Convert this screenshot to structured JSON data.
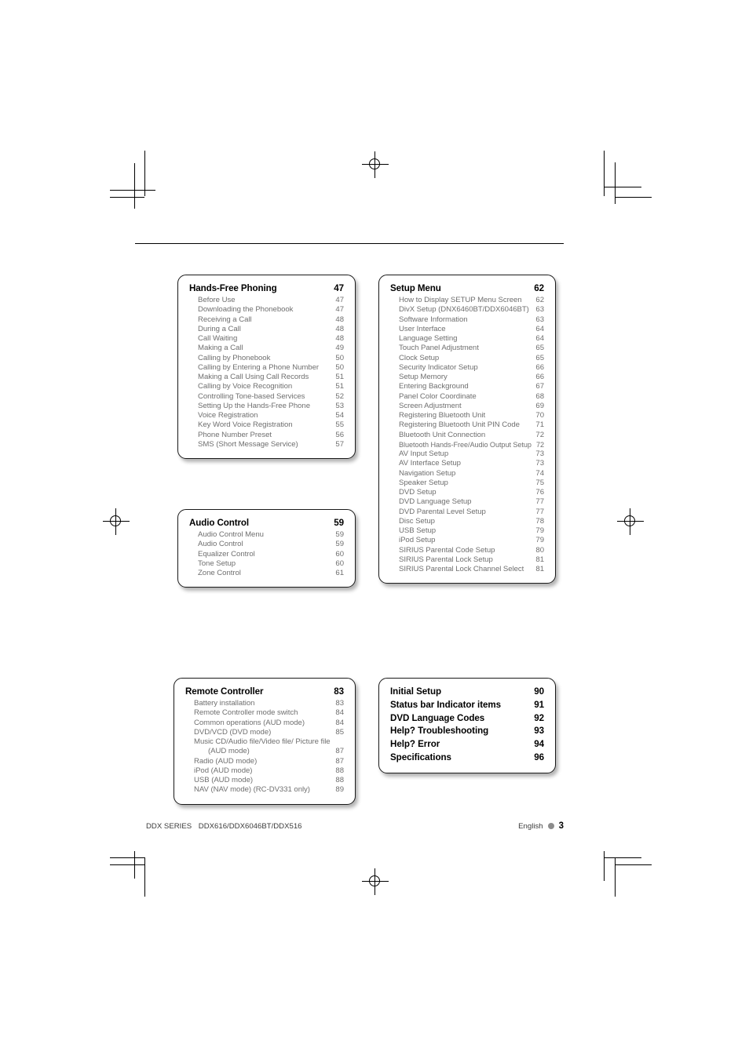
{
  "page": {
    "footer": {
      "series_label": "DDX SERIES",
      "models": "DDX616/DDX6046BT/DDX516",
      "language": "English",
      "page_number": "3"
    }
  },
  "toc_boxes": [
    {
      "id": "hands-free-phoning",
      "title": "Hands-Free Phoning",
      "page": "47",
      "items": [
        {
          "label": "Before Use",
          "page": "47"
        },
        {
          "label": "Downloading the Phonebook",
          "page": "47"
        },
        {
          "label": "Receiving a Call",
          "page": "48"
        },
        {
          "label": "During a Call",
          "page": "48"
        },
        {
          "label": "Call Waiting",
          "page": "48"
        },
        {
          "label": "Making a Call",
          "page": "49"
        },
        {
          "label": "Calling by Phonebook",
          "page": "50"
        },
        {
          "label": "Calling by Entering a Phone Number",
          "page": "50"
        },
        {
          "label": "Making a Call Using Call Records",
          "page": "51"
        },
        {
          "label": "Calling by Voice Recognition",
          "page": "51"
        },
        {
          "label": "Controlling Tone-based Services",
          "page": "52"
        },
        {
          "label": "Setting Up the Hands-Free Phone",
          "page": "53"
        },
        {
          "label": "Voice Registration",
          "page": "54"
        },
        {
          "label": "Key Word Voice Registration",
          "page": "55"
        },
        {
          "label": "Phone Number Preset",
          "page": "56"
        },
        {
          "label": "SMS (Short Message Service)",
          "page": "57"
        }
      ]
    },
    {
      "id": "setup-menu",
      "title": "Setup Menu",
      "page": "62",
      "items": [
        {
          "label": "How to Display SETUP Menu Screen",
          "page": "62"
        },
        {
          "label": "DivX Setup (DNX6460BT/DDX6046BT)",
          "page": "63"
        },
        {
          "label": "Software Information",
          "page": "63"
        },
        {
          "label": "User Interface",
          "page": "64"
        },
        {
          "label": "Language Setting",
          "page": "64"
        },
        {
          "label": "Touch Panel Adjustment",
          "page": "65"
        },
        {
          "label": "Clock Setup",
          "page": "65"
        },
        {
          "label": "Security Indicator Setup",
          "page": "66"
        },
        {
          "label": "Setup Memory",
          "page": "66"
        },
        {
          "label": "Entering Background",
          "page": "67"
        },
        {
          "label": "Panel Color Coordinate",
          "page": "68"
        },
        {
          "label": "Screen Adjustment",
          "page": "69"
        },
        {
          "label": "Registering Bluetooth Unit",
          "page": "70"
        },
        {
          "label": "Registering Bluetooth Unit PIN Code",
          "page": "71"
        },
        {
          "label": "Bluetooth Unit Connection",
          "page": "72"
        },
        {
          "label": "Bluetooth Hands-Free/Audio Output Setup",
          "page": "72"
        },
        {
          "label": "AV Input Setup",
          "page": "73"
        },
        {
          "label": "AV Interface Setup",
          "page": "73"
        },
        {
          "label": "Navigation Setup",
          "page": "74"
        },
        {
          "label": "Speaker Setup",
          "page": "75"
        },
        {
          "label": "DVD Setup",
          "page": "76"
        },
        {
          "label": "DVD Language Setup",
          "page": "77"
        },
        {
          "label": "DVD Parental Level Setup",
          "page": "77"
        },
        {
          "label": "Disc Setup",
          "page": "78"
        },
        {
          "label": "USB Setup",
          "page": "79"
        },
        {
          "label": "iPod Setup",
          "page": "79"
        },
        {
          "label": "SIRIUS Parental Code Setup",
          "page": "80"
        },
        {
          "label": "SIRIUS Parental Lock Setup",
          "page": "81"
        },
        {
          "label": "SIRIUS Parental Lock Channel Select",
          "page": "81"
        }
      ]
    },
    {
      "id": "audio-control",
      "title": "Audio Control",
      "page": "59",
      "items": [
        {
          "label": "Audio Control Menu",
          "page": "59"
        },
        {
          "label": "Audio Control",
          "page": "59"
        },
        {
          "label": "Equalizer Control",
          "page": "60"
        },
        {
          "label": "Tone Setup",
          "page": "60"
        },
        {
          "label": "Zone Control",
          "page": "61"
        }
      ]
    },
    {
      "id": "remote-controller",
      "title": "Remote Controller",
      "page": "83",
      "items": [
        {
          "label": "Battery installation",
          "page": "83"
        },
        {
          "label": "Remote Controller mode switch",
          "page": "84"
        },
        {
          "label": "Common operations (AUD mode)",
          "page": "84"
        },
        {
          "label": "DVD/VCD (DVD mode)",
          "page": "85"
        },
        {
          "label": "Music CD/Audio file/Video file/ Picture file",
          "label2": "(AUD mode)",
          "page": "87"
        },
        {
          "label": "Radio (AUD mode)",
          "page": "87"
        },
        {
          "label": "iPod (AUD mode)",
          "page": "88"
        },
        {
          "label": "USB (AUD mode)",
          "page": "88"
        },
        {
          "label": "NAV (NAV mode) (RC-DV331 only)",
          "page": "89"
        }
      ]
    },
    {
      "id": "appendix",
      "title": null,
      "page": null,
      "items": [
        {
          "label": "Initial Setup",
          "page": "90"
        },
        {
          "label": "Status bar Indicator items",
          "page": "91"
        },
        {
          "label": "DVD Language Codes",
          "page": "92"
        },
        {
          "label": "Help? Troubleshooting",
          "page": "93"
        },
        {
          "label": "Help? Error",
          "page": "94"
        },
        {
          "label": "Specifications",
          "page": "96"
        }
      ]
    }
  ]
}
